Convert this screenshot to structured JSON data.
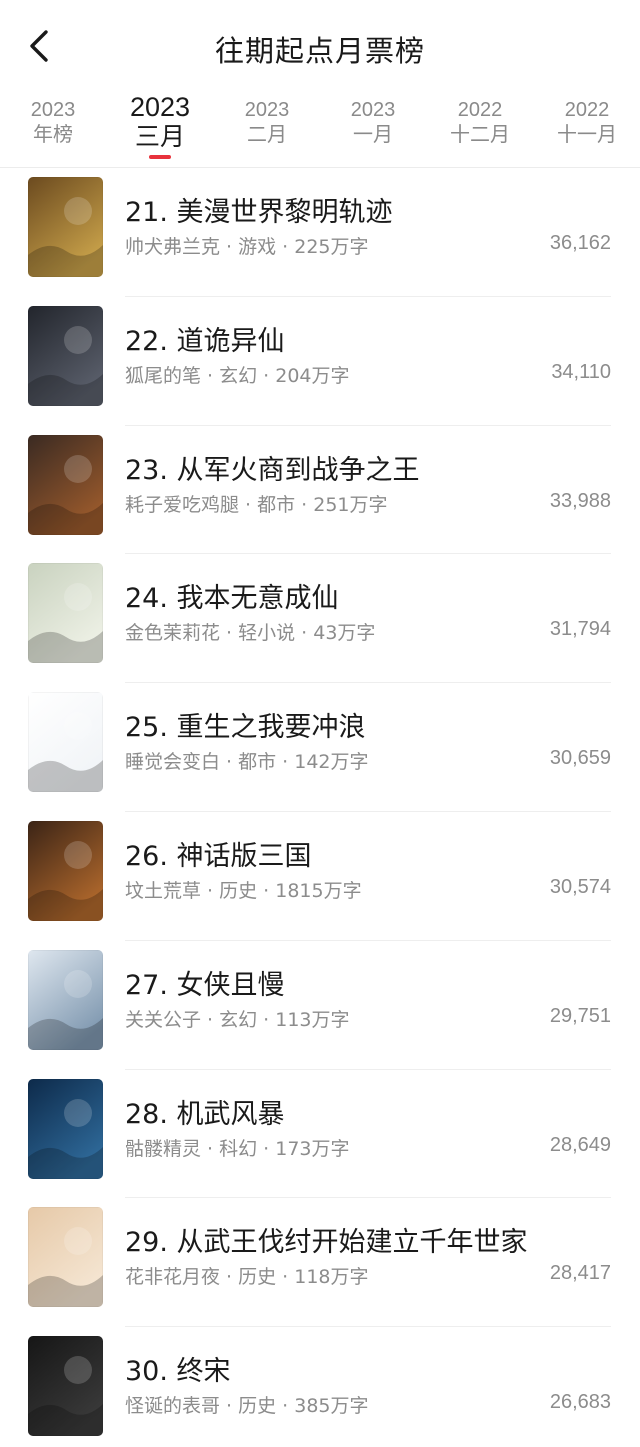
{
  "header": {
    "title": "往期起点月票榜"
  },
  "tabs": [
    {
      "year": "2023",
      "month": "年榜",
      "active": false
    },
    {
      "year": "2023",
      "month": "三月",
      "active": true
    },
    {
      "year": "2023",
      "month": "二月",
      "active": false
    },
    {
      "year": "2023",
      "month": "一月",
      "active": false
    },
    {
      "year": "2022",
      "month": "十二月",
      "active": false
    },
    {
      "year": "2022",
      "month": "十一月",
      "active": false
    }
  ],
  "books": [
    {
      "title": "21. 美漫世界黎明轨迹",
      "meta": "帅犬弗兰克 · 游戏 · 225万字",
      "score": "36,162",
      "cover_colors": [
        "#6b4a1f",
        "#c9a24a"
      ],
      "cover_icon": "cover-art-fantasy"
    },
    {
      "title": "22. 道诡异仙",
      "meta": "狐尾的笔 · 玄幻 · 204万字",
      "score": "34,110",
      "cover_colors": [
        "#22252c",
        "#5a5f6b"
      ],
      "cover_icon": "cover-art-dark"
    },
    {
      "title": "23. 从军火商到战争之王",
      "meta": "耗子爱吃鸡腿 · 都市 · 251万字",
      "score": "33,988",
      "cover_colors": [
        "#3a2a22",
        "#9a5a2c"
      ],
      "cover_icon": "cover-art-soldier"
    },
    {
      "title": "24. 我本无意成仙",
      "meta": "金色茉莉花 · 轻小说 · 43万字",
      "score": "31,794",
      "cover_colors": [
        "#c9d2bf",
        "#eef1e6"
      ],
      "cover_icon": "cover-art-landscape"
    },
    {
      "title": "25. 重生之我要冲浪",
      "meta": "睡觉会变白 · 都市 · 142万字",
      "score": "30,659",
      "cover_colors": [
        "#ffffff",
        "#f1f4f7"
      ],
      "cover_icon": "cover-art-cartoon"
    },
    {
      "title": "26. 神话版三国",
      "meta": "坟土荒草 · 历史 · 1815万字",
      "score": "30,574",
      "cover_colors": [
        "#3b2416",
        "#b0682c"
      ],
      "cover_icon": "cover-art-warrior"
    },
    {
      "title": "27. 女侠且慢",
      "meta": "关关公子 · 玄幻 · 113万字",
      "score": "29,751",
      "cover_colors": [
        "#dfe7ef",
        "#7f98b0"
      ],
      "cover_icon": "cover-art-ink"
    },
    {
      "title": "28. 机武风暴",
      "meta": "骷髅精灵 · 科幻 · 173万字",
      "score": "28,649",
      "cover_colors": [
        "#0d2a4a",
        "#2f6a9a"
      ],
      "cover_icon": "cover-art-mecha"
    },
    {
      "title": "29. 从武王伐纣开始建立千年世家",
      "meta": "花非花月夜 · 历史 · 118万字",
      "score": "28,417",
      "cover_colors": [
        "#e6c9a8",
        "#f5e6d3"
      ],
      "cover_icon": "cover-art-pavilion"
    },
    {
      "title": "30. 终宋",
      "meta": "怪诞的表哥 · 历史 · 385万字",
      "score": "26,683",
      "cover_colors": [
        "#161616",
        "#3a3a3a"
      ],
      "cover_icon": "cover-art-calligraphy"
    }
  ]
}
